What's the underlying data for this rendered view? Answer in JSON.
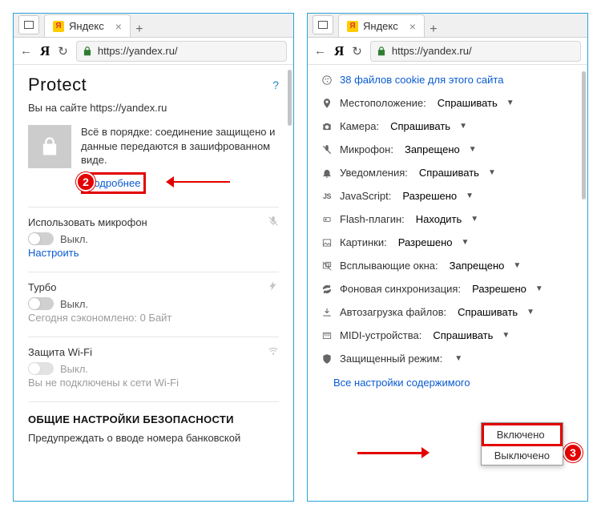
{
  "tab": {
    "title": "Яндекс",
    "url": "https://yandex.ru/"
  },
  "left": {
    "title": "Protect",
    "help": "?",
    "site_line": "Вы на сайте https://yandex.ru",
    "secure_text": "Всё в порядке: соединение защищено и данные передаются в зашифрованном виде.",
    "details_link": "Подробнее",
    "badge2": "2",
    "mic": {
      "label": "Использовать микрофон",
      "state": "Выкл.",
      "configure": "Настроить"
    },
    "turbo": {
      "label": "Турбо",
      "state": "Выкл.",
      "saved": "Сегодня сэкономлено: 0 Байт"
    },
    "wifi": {
      "label": "Защита Wi-Fi",
      "state": "Выкл.",
      "note": "Вы не подключены к сети Wi-Fi"
    },
    "security_title": "ОБЩИЕ НАСТРОЙКИ БЕЗОПАСНОСТИ",
    "bank_warn": "Предупреждать о вводе номера банковской"
  },
  "right": {
    "cookies": "38 файлов cookie для этого сайта",
    "perms": [
      {
        "icon": "location",
        "label": "Местоположение",
        "value": "Спрашивать"
      },
      {
        "icon": "camera",
        "label": "Камера",
        "value": "Спрашивать"
      },
      {
        "icon": "mic",
        "label": "Микрофон",
        "value": "Запрещено"
      },
      {
        "icon": "bell",
        "label": "Уведомления",
        "value": "Спрашивать"
      },
      {
        "icon": "js",
        "label": "JavaScript",
        "value": "Разрешено"
      },
      {
        "icon": "flash",
        "label": "Flash-плагин",
        "value": "Находить"
      },
      {
        "icon": "image",
        "label": "Картинки",
        "value": "Разрешено"
      },
      {
        "icon": "popup",
        "label": "Всплывающие окна",
        "value": "Запрещено"
      },
      {
        "icon": "sync",
        "label": "Фоновая синхронизация",
        "value": "Разрешено"
      },
      {
        "icon": "download",
        "label": "Автозагрузка файлов",
        "value": "Спрашивать"
      },
      {
        "icon": "midi",
        "label": "MIDI-устройства",
        "value": "Спрашивать"
      },
      {
        "icon": "shield",
        "label": "Защищенный режим",
        "value": ""
      }
    ],
    "dropdown": {
      "on": "Включено",
      "off": "Выключено"
    },
    "all_settings": "Все настройки содержимого",
    "badge3": "3"
  }
}
